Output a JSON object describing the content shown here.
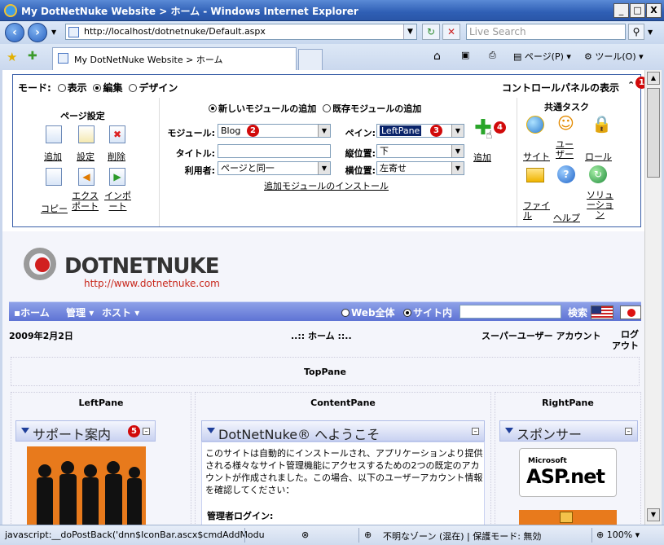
{
  "window": {
    "title": "My DotNetNuke Website > ホーム - Windows Internet Explorer",
    "minimize": "_",
    "maximize": "□",
    "close": "X"
  },
  "addressbar": {
    "url": "http://localhost/dotnetnuke/Default.aspx",
    "search_placeholder": "Live Search"
  },
  "tabbar": {
    "tab_title": "My DotNetNuke Website > ホーム",
    "tools": {
      "page": "ページ(P)",
      "tools": "ツール(O)"
    }
  },
  "control_panel": {
    "mode_label": "モード:",
    "modes": [
      "表示",
      "編集",
      "デザイン"
    ],
    "selected_mode": "編集",
    "show_panel": "コントロールパネルの表示",
    "page_settings": {
      "heading": "ページ設定",
      "items": [
        "追加",
        "設定",
        "削除",
        "コピー",
        "エクスポート",
        "インポート"
      ],
      "item_lines": {
        "export_1": "エクス",
        "export_2": "ポート",
        "import_1": "インポ",
        "import_2": "ート"
      }
    },
    "module": {
      "add_new": "新しいモジュールの追加",
      "add_existing": "既存モジュールの追加",
      "module_label": "モジュール:",
      "module_value": "Blog",
      "title_label": "タイトル:",
      "title_value": "",
      "user_label": "利用者:",
      "user_value": "ページと同一",
      "pane_label": "ペイン:",
      "pane_value": "LeftPane",
      "vpos_label": "縦位置:",
      "vpos_value": "下",
      "hpos_label": "横位置:",
      "hpos_value": "左寄せ",
      "add_button": "追加",
      "install_link": "追加モジュールのインストール"
    },
    "common_tasks": {
      "heading": "共通タスク",
      "items": [
        "サイト",
        "ユーザー",
        "ロール",
        "ファイル",
        "ヘルプ",
        "ソリューション"
      ],
      "item_lines": {
        "user_1": "ユー",
        "user_2": "ザー",
        "files_1": "ファイ",
        "files_2": "ル",
        "sol_1": "ソリュ",
        "sol_2": "ーショ",
        "sol_3": "ン"
      }
    },
    "badges": [
      "1",
      "2",
      "3",
      "4",
      "5"
    ]
  },
  "site": {
    "logo": "DOTNETNUKE",
    "logo_url": "http://www.dotnetnuke.com",
    "nav": [
      "ホーム",
      "管理",
      "ホスト"
    ],
    "search_scope": [
      "Web全体",
      "サイト内"
    ],
    "selected_scope": "サイト内",
    "search_button": "検索",
    "date": "2009年2月2日",
    "breadcrumb": "..:: ホーム ::..",
    "user": "スーパーユーザー アカウント",
    "logout_1": "ログ",
    "logout_2": "アウト",
    "panes": {
      "top": "TopPane",
      "left": "LeftPane",
      "content": "ContentPane",
      "right": "RightPane"
    },
    "modules": {
      "support": "サポート案内",
      "welcome": "DotNetNuke® へようこそ",
      "sponsor": "スポンサー",
      "welcome_body": "このサイトは自動的にインストールされ、アプリケーションより提供される様々なサイト管理機能にアクセスするための2つの既定のアカウントが作成されました。この場合、以下のユーザーアカウント情報を確認してください：",
      "admin_login": "管理者ログイン:",
      "sponsor_logo_small": "Microsoft",
      "sponsor_logo": "ASP.net"
    }
  },
  "statusbar": {
    "text": "javascript:__doPostBack('dnn$IconBar.ascx$cmdAddModu",
    "zone": "不明なゾーン (混在) | 保護モード: 無効",
    "zoom": "100%"
  },
  "colors": {
    "accent_blue": "#3a5fa8",
    "badge_red": "#d10a0a",
    "navbar": "#6a7fd8"
  }
}
